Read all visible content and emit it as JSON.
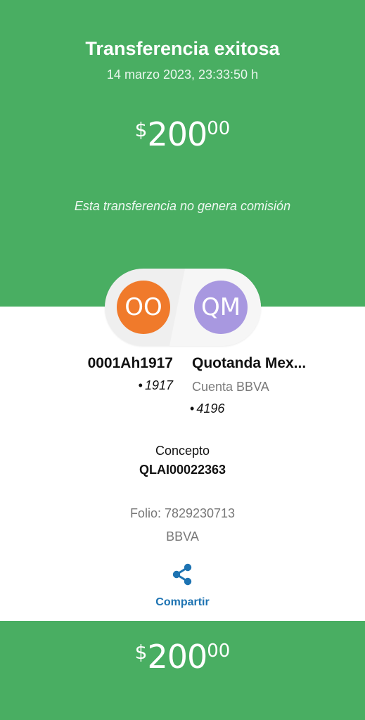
{
  "header": {
    "title": "Transferencia exitosa",
    "datetime": "14 marzo 2023, 23:33:50 h",
    "amount": {
      "currency": "$",
      "integer": "200",
      "decimal": "00"
    },
    "note": "Esta transferencia no genera comisión"
  },
  "avatars": {
    "origin_initials": "OO",
    "destination_initials": "QM"
  },
  "origin": {
    "name": "0001Ah1917",
    "account": "1917"
  },
  "destination": {
    "name": "Quotanda Mex...",
    "account_type": "Cuenta BBVA",
    "account": "4196"
  },
  "concept": {
    "label": "Concepto",
    "value": "QLAI00022363"
  },
  "folio": "Folio: 7829230713",
  "bank": "BBVA",
  "share": {
    "icon": "share-icon",
    "label": "Compartir"
  },
  "footer": {
    "amount": {
      "currency": "$",
      "integer": "200",
      "decimal": "00"
    }
  },
  "colors": {
    "primary_green": "#49ae62",
    "avatar_orange": "#f07a2b",
    "avatar_purple": "#a898e0",
    "link_blue": "#1d73b2"
  }
}
